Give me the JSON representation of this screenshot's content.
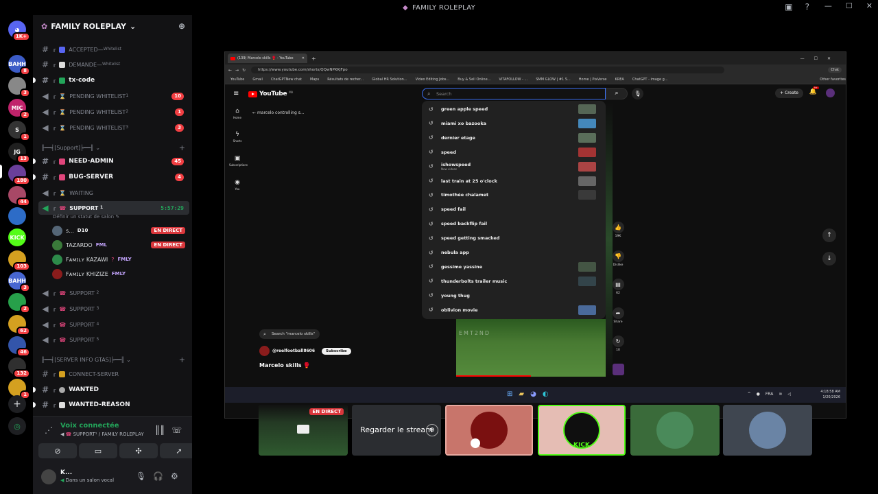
{
  "titlebar": {
    "title": "FAMILY ROLEPLAY"
  },
  "rail": {
    "servers": [
      {
        "label": "",
        "badge": "1K+",
        "color": "#5865f2"
      },
      {
        "label": "BAHH",
        "badge": "8",
        "color": "#3c5cc7"
      },
      {
        "label": "",
        "badge": "3",
        "color": "#888888"
      },
      {
        "label": "MIC",
        "badge": "2",
        "color": "#c0236b"
      },
      {
        "label": "S",
        "badge": "1",
        "color": "#333333"
      },
      {
        "label": "JG",
        "badge": "13",
        "color": "#1f1f1f"
      },
      {
        "label": "",
        "badge": "180",
        "color": "#6a3f9a"
      },
      {
        "label": "",
        "badge": "44",
        "color": "#a84866"
      },
      {
        "label": "",
        "badge": "",
        "color": "#2d6cc7"
      },
      {
        "label": "KICK",
        "badge": "",
        "color": "#53fc18"
      },
      {
        "label": "",
        "badge": "103",
        "color": "#d4a020"
      },
      {
        "label": "BAHH",
        "badge": "3",
        "color": "#4766d1"
      },
      {
        "label": "",
        "badge": "2",
        "color": "#27a04a"
      },
      {
        "label": "",
        "badge": "62",
        "color": "#d4a020"
      },
      {
        "label": "",
        "badge": "46",
        "color": "#3355aa"
      },
      {
        "label": "",
        "badge": "132",
        "color": "#2f2f2f"
      },
      {
        "label": "",
        "badge": "1",
        "color": "#d4a020"
      }
    ]
  },
  "server": {
    "name": "FAMILY ROLEPLAY"
  },
  "channels": {
    "accepted": "ACCEPTED",
    "accepted_sup": "Whitelist",
    "demande": "DEMANDE",
    "demande_sup": "Whitelist",
    "txcode": "tx-code",
    "pending1": "PENDING WHITELIST",
    "pending1_sup": "1",
    "pending1_count": "10",
    "pending2": "PENDING WHITELIST",
    "pending2_sup": "2",
    "pending2_count": "1",
    "pending3": "PENDING WHITELIST",
    "pending3_sup": "3",
    "pending3_count": "3",
    "support_category": "╟━━╡[Support]╞━━╢",
    "need_admin": "NEED-ADMIN",
    "need_admin_count": "45",
    "bug_server": "BUG-SERVER",
    "bug_server_count": "4",
    "waiting": "WAITING",
    "support1": "SUPPORT",
    "support1_sup": "1",
    "support1_timer": "5:57:29",
    "support1_status": "Définir un statut de salon",
    "support2": "SUPPORT",
    "support2_sup": "2",
    "support3": "SUPPORT",
    "support3_sup": "3",
    "support4": "SUPPORT",
    "support4_sup": "4",
    "support5": "SUPPORT",
    "support5_sup": "5",
    "info_category": "╟━━╡[SERVER INFO GTAS]╞━━╢",
    "connect": "CONNECT-SERVER",
    "wanted": "WANTED",
    "wanted_reason": "WANTED-REASON"
  },
  "voice_users": [
    {
      "name": "ꜱ...",
      "tag": "D10",
      "live": "EN DIRECT",
      "color": "#556677"
    },
    {
      "name": "TAZARDO",
      "tag": "FML",
      "live": "EN DIRECT",
      "color": "#3a7a3a"
    },
    {
      "name": "KAZAWI",
      "prefix": "Fᴀᴍɪʟʏ",
      "tag": "FMLY",
      "live": "",
      "color": "#2d8a4a"
    },
    {
      "name": "KHIZIZE",
      "prefix": "Fᴀᴍɪʟʏ",
      "tag": "FMLY",
      "live": "",
      "color": "#8a1c1c"
    }
  ],
  "voice_panel": {
    "status": "Voix connectée",
    "channel": "SUPPORT¹ / FAMILY ROLEPLAY"
  },
  "user_panel": {
    "name": "K...",
    "status": "Dans un salon vocal"
  },
  "browser": {
    "tab_title": "(139) Marcelo skills 🥊 - YouTube",
    "url": "https://www.youtube.com/shorts/QQwNPKKjFpo",
    "chat_label": "Chat",
    "bookmarks": [
      "YouTube",
      "Gmail",
      "ChatGPTNew chat",
      "Maps",
      "Résultats de recher...",
      "Global HR Solution...",
      "Video Editing Jobs...",
      "Buy & Sell Online...",
      "VITAFOLLOW - ...",
      "SMM GLOW | #1 S...",
      "Home | PixVerse",
      "KREA",
      "ChatGPT - image g...",
      "Other favorites"
    ]
  },
  "youtube": {
    "logo": "YouTube",
    "region": "MA",
    "search_placeholder": "Search",
    "back_text": "marcelo controlling s...",
    "nav": [
      "Home",
      "Shorts",
      "Subscriptions",
      "You"
    ],
    "create": "Create",
    "notif_count": "9+",
    "suggestions": [
      {
        "text": "green apple speed",
        "thumb": "#556655",
        "sub": ""
      },
      {
        "text": "miami xo bazooka",
        "thumb": "#4488bb",
        "sub": ""
      },
      {
        "text": "dernier etage",
        "thumb": "#5a6e5a",
        "sub": ""
      },
      {
        "text": "speed",
        "thumb": "#a33333",
        "sub": ""
      },
      {
        "text": "ishowspeed",
        "thumb": "#aa4444",
        "sub": "New videos"
      },
      {
        "text": "last train at 25 o'clock",
        "thumb": "#666666",
        "sub": ""
      },
      {
        "text": "timothée chalamet",
        "thumb": "#3a3a3a",
        "sub": ""
      },
      {
        "text": "speed fail",
        "thumb": "",
        "sub": ""
      },
      {
        "text": "speed backflip fail",
        "thumb": "",
        "sub": ""
      },
      {
        "text": "speed getting smacked",
        "thumb": "",
        "sub": ""
      },
      {
        "text": "nebula app",
        "thumb": "",
        "sub": ""
      },
      {
        "text": "gessime yassine",
        "thumb": "#445544",
        "sub": ""
      },
      {
        "text": "thunderbolts trailer music",
        "thumb": "#33444a",
        "sub": ""
      },
      {
        "text": "young thug",
        "thumb": "",
        "sub": ""
      },
      {
        "text": "oblivion movie",
        "thumb": "#4a6a9a",
        "sub": ""
      }
    ],
    "watermark": "EMT2ND",
    "likes": "19K",
    "dislike": "Dislike",
    "comments": "62",
    "share": "Share",
    "remix": "10",
    "search_query_chip": "Search \"marcelo skills\"",
    "channel": "@reelfootball8606",
    "subscribe": "Subscribe",
    "video_title": "Marcelo skills 🥊"
  },
  "taskbar": {
    "lang": "FRA",
    "time": "4:18:58 AM",
    "date": "1/20/2026"
  },
  "tiles": {
    "stream_badge": "EN DIRECT",
    "watch_label": "Regarder le stream"
  }
}
